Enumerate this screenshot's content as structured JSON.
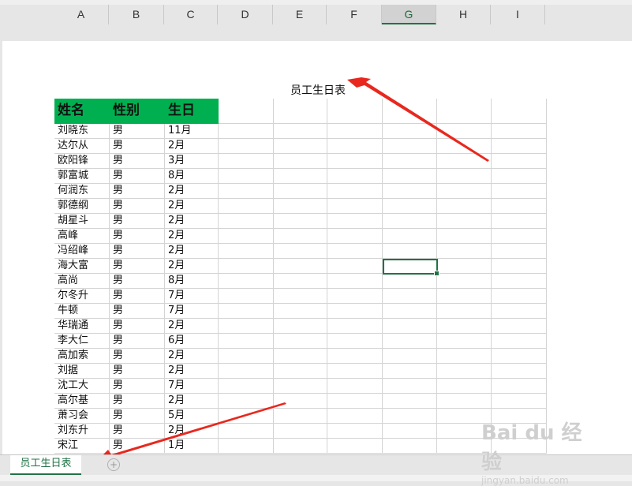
{
  "column_headers": [
    "A",
    "B",
    "C",
    "D",
    "E",
    "F",
    "G",
    "H",
    "I"
  ],
  "selected_column": "G",
  "sheet_title": "员工生日表",
  "table": {
    "headers": [
      "姓名",
      "性别",
      "生日"
    ],
    "rows": [
      [
        "刘晓东",
        "男",
        "11月"
      ],
      [
        "达尔从",
        "男",
        "2月"
      ],
      [
        "欧阳锋",
        "男",
        "3月"
      ],
      [
        "郭富城",
        "男",
        "8月"
      ],
      [
        "何润东",
        "男",
        "2月"
      ],
      [
        "郭德纲",
        "男",
        "2月"
      ],
      [
        "胡星斗",
        "男",
        "2月"
      ],
      [
        "高峰",
        "男",
        "2月"
      ],
      [
        "冯绍峰",
        "男",
        "2月"
      ],
      [
        "海大富",
        "男",
        "2月"
      ],
      [
        "高尚",
        "男",
        "8月"
      ],
      [
        "尔冬升",
        "男",
        "7月"
      ],
      [
        "牛顿",
        "男",
        "7月"
      ],
      [
        "华瑞通",
        "男",
        "2月"
      ],
      [
        "李大仁",
        "男",
        "6月"
      ],
      [
        "高加索",
        "男",
        "2月"
      ],
      [
        "刘据",
        "男",
        "2月"
      ],
      [
        "沈工大",
        "男",
        "7月"
      ],
      [
        "高尔基",
        "男",
        "2月"
      ],
      [
        "萧习会",
        "男",
        "5月"
      ],
      [
        "刘东升",
        "男",
        "2月"
      ],
      [
        "宋江",
        "男",
        "1月"
      ]
    ]
  },
  "sheet_tab_label": "员工生日表",
  "add_sheet_symbol": "+",
  "colors": {
    "header_fill": "#00b050",
    "accent": "#217346",
    "arrow": "#e8281e"
  },
  "watermark": {
    "brand": "Bai du 经验",
    "url": "jingyan.baidu.com"
  }
}
